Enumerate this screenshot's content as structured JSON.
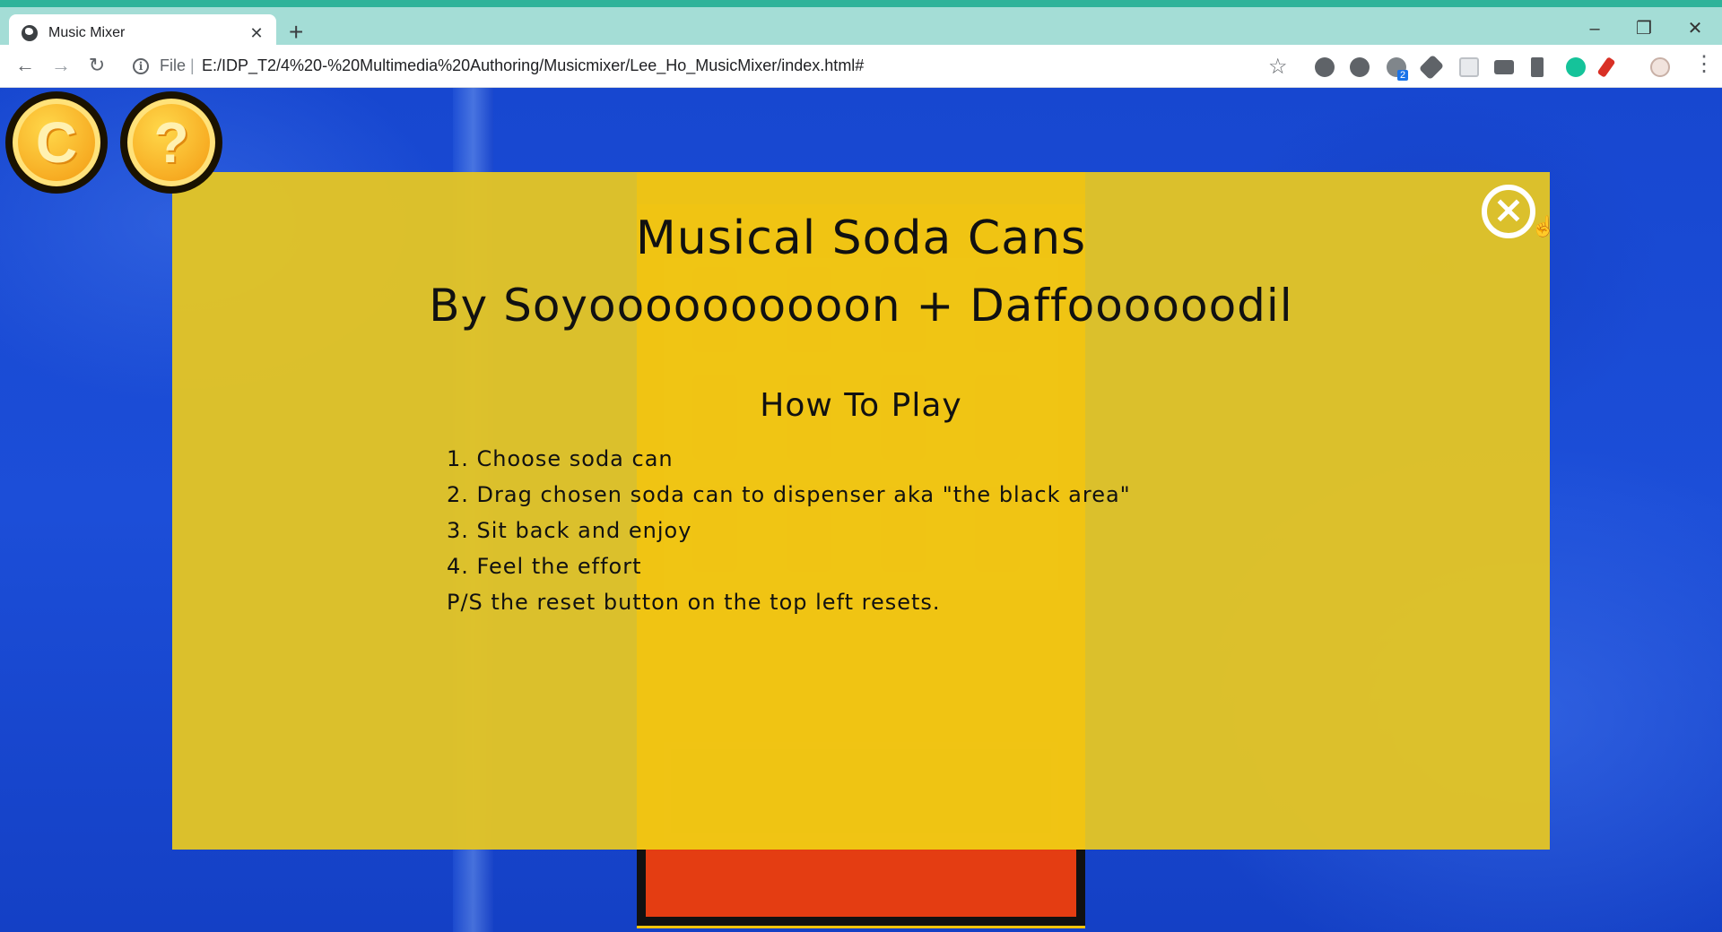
{
  "browser": {
    "tab_title": "Music Mixer",
    "tab_close": "✕",
    "new_tab": "+",
    "window_controls": {
      "minimize": "–",
      "restore": "❐",
      "close": "✕"
    },
    "nav": {
      "back": "←",
      "forward": "→",
      "reload": "↻"
    },
    "scheme_label": "File",
    "url_separator": "|",
    "url": "E:/IDP_T2/4%20-%20Multimedia%20Authoring/Musicmixer/Lee_Ho_MusicMixer/index.html#",
    "bookmark_icon": "☆",
    "extension_badge": "2"
  },
  "game": {
    "reset_glyph": "C",
    "help_glyph": "?",
    "close_glyph": "×",
    "title": "Musical Soda Cans",
    "authors": "By Soyoooooooooon + Daffoooooodil",
    "how_to_heading": "How To Play",
    "instructions": [
      "1. Choose soda can",
      "2. Drag chosen soda can to dispenser aka \"the black area\"",
      "3. Sit back and enjoy",
      "4. Feel the effort",
      "P/S the reset button on the top left resets."
    ]
  },
  "colors": {
    "tab_strip": "#a4ddd6",
    "accent_stripe": "#2fb39a",
    "background_blue": "#1c4ed8",
    "panel_yellow": "#e2c426",
    "machine_yellow": "#f9c409",
    "machine_red": "#e43d12"
  }
}
